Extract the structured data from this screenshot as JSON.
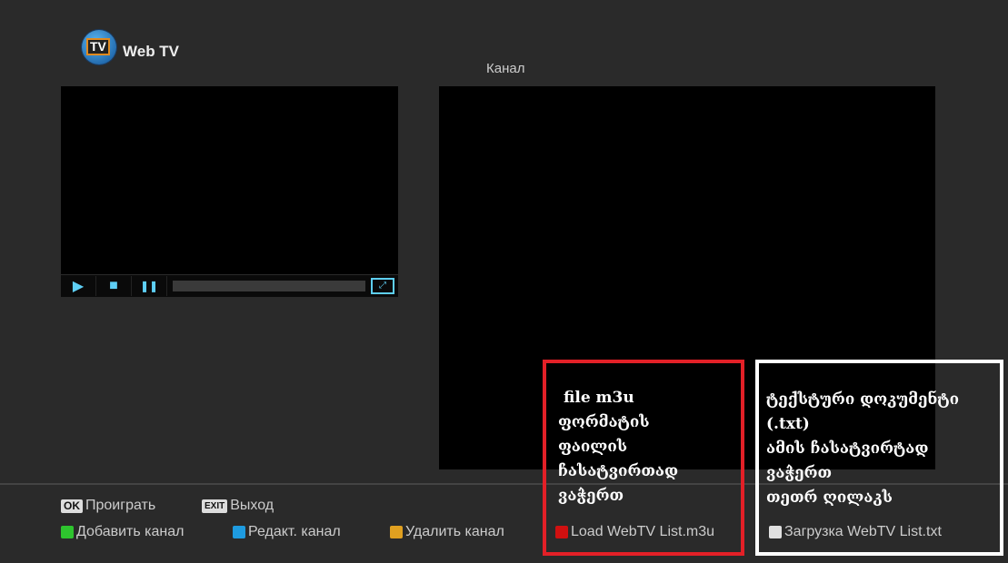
{
  "header": {
    "app_title": "Web TV",
    "logo_text": "TV",
    "channel_label": "Канал"
  },
  "player": {
    "play_icon": "▶",
    "stop_icon": "■",
    "pause_icon": "❚❚",
    "fullscreen_icon": "⤢"
  },
  "hints": {
    "ok_key": "OK",
    "ok_label": "Проиграть",
    "exit_key": "EXIT",
    "exit_label": "Выход",
    "green_label": "Добавить канал",
    "blue_label": "Редакт. канал",
    "yellow_label": "Удалить канал",
    "red_label": "Load WebTV List.m3u",
    "white_label": "Загрузка WebTV List.txt"
  },
  "annotations": {
    "red": [
      "file m3u",
      "ფორმატის",
      "ფაილის",
      "ჩასატვირთად",
      "ვაჭერთ"
    ],
    "white": [
      "ტექსტური დოკუმენტი",
      "(.txt)",
      "ამის ჩასატვირტად",
      "ვაჭერთ",
      "თეთრ ღილაკს"
    ]
  },
  "colors": {
    "green": "#2ec42e",
    "blue": "#1e9be0",
    "yellow": "#e0a020",
    "red": "#d01010",
    "white": "#e0e0e0",
    "annotation_red": "#e32027"
  }
}
